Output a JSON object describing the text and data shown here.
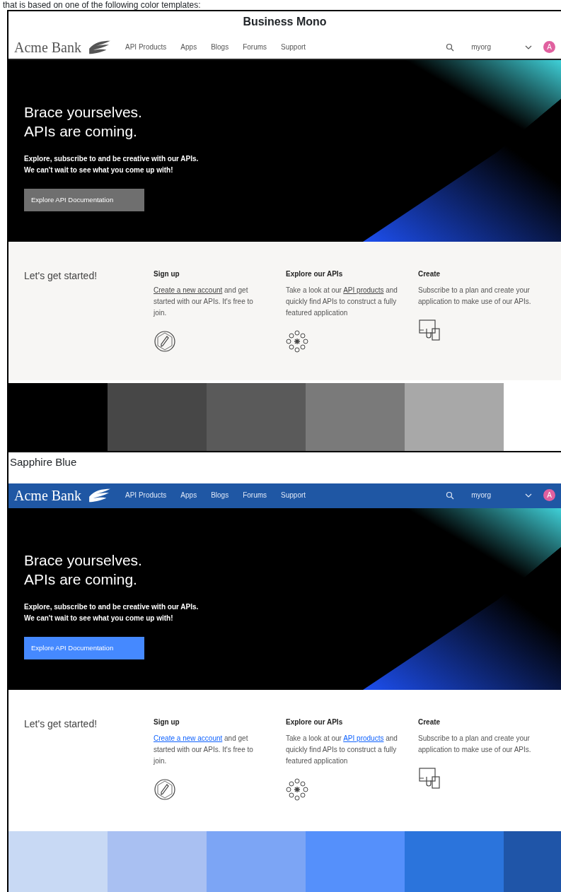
{
  "caption": "that is based on one of the following color templates:",
  "templates": [
    {
      "title": "Business Mono",
      "kind": "mono",
      "site": {
        "brand": "Acme Bank",
        "nav": [
          "API Products",
          "Apps",
          "Blogs",
          "Forums",
          "Support"
        ],
        "org": "myorg",
        "avatar": "A",
        "hero": {
          "heading": [
            "Brace yourselves.",
            "APIs are coming."
          ],
          "text": [
            "Explore, subscribe to and be creative with our APIs.",
            "We can't wait to see what you come up with!"
          ],
          "button": "Explore API Documentation"
        },
        "start": {
          "heading": "Let's get started!",
          "cards": [
            {
              "title": "Sign up",
              "link": "Create a new account",
              "after": " and get started with our APIs. It's free to join."
            },
            {
              "title": "Explore our APIs",
              "before": "Take a look at our ",
              "link": "API products",
              "after": " and quickly find APIs to construct a fully featured application"
            },
            {
              "title": "Create",
              "before": "Subscribe to a plan and create your application to make use of our APIs."
            }
          ]
        }
      },
      "swatches": [
        {
          "color": "#000000"
        },
        {
          "color": "#474747"
        },
        {
          "color": "#5a5a5a"
        },
        {
          "color": "#7a7a7a"
        },
        {
          "color": "#a8a8a8"
        }
      ]
    },
    {
      "title": "Sapphire Blue",
      "kind": "sapphire",
      "site": {
        "brand": "Acme Bank",
        "nav": [
          "API Products",
          "Apps",
          "Blogs",
          "Forums",
          "Support"
        ],
        "org": "myorg",
        "avatar": "A",
        "hero": {
          "heading": [
            "Brace yourselves.",
            "APIs are coming."
          ],
          "text": [
            "Explore, subscribe to and be creative with our APIs.",
            "We can't wait to see what you come up with!"
          ],
          "button": "Explore API Documentation"
        },
        "start": {
          "heading": "Let's get started!",
          "cards": [
            {
              "title": "Sign up",
              "link": "Create a new account",
              "after": " and get started with our APIs. It's free to join."
            },
            {
              "title": "Explore our APIs",
              "before": "Take a look at our ",
              "link": "API products",
              "after": " and quickly find APIs to construct a fully featured application"
            },
            {
              "title": "Create",
              "before": "Subscribe to a plan and create your application to make use of our APIs."
            }
          ]
        }
      },
      "swatches": [
        {
          "color": "#c8d9f4"
        },
        {
          "color": "#a9c0f2"
        },
        {
          "color": "#7ca5f5"
        },
        {
          "color": "#5590fb"
        },
        {
          "color": "#2b74dc"
        },
        {
          "color": "#1f55a8"
        }
      ]
    }
  ]
}
